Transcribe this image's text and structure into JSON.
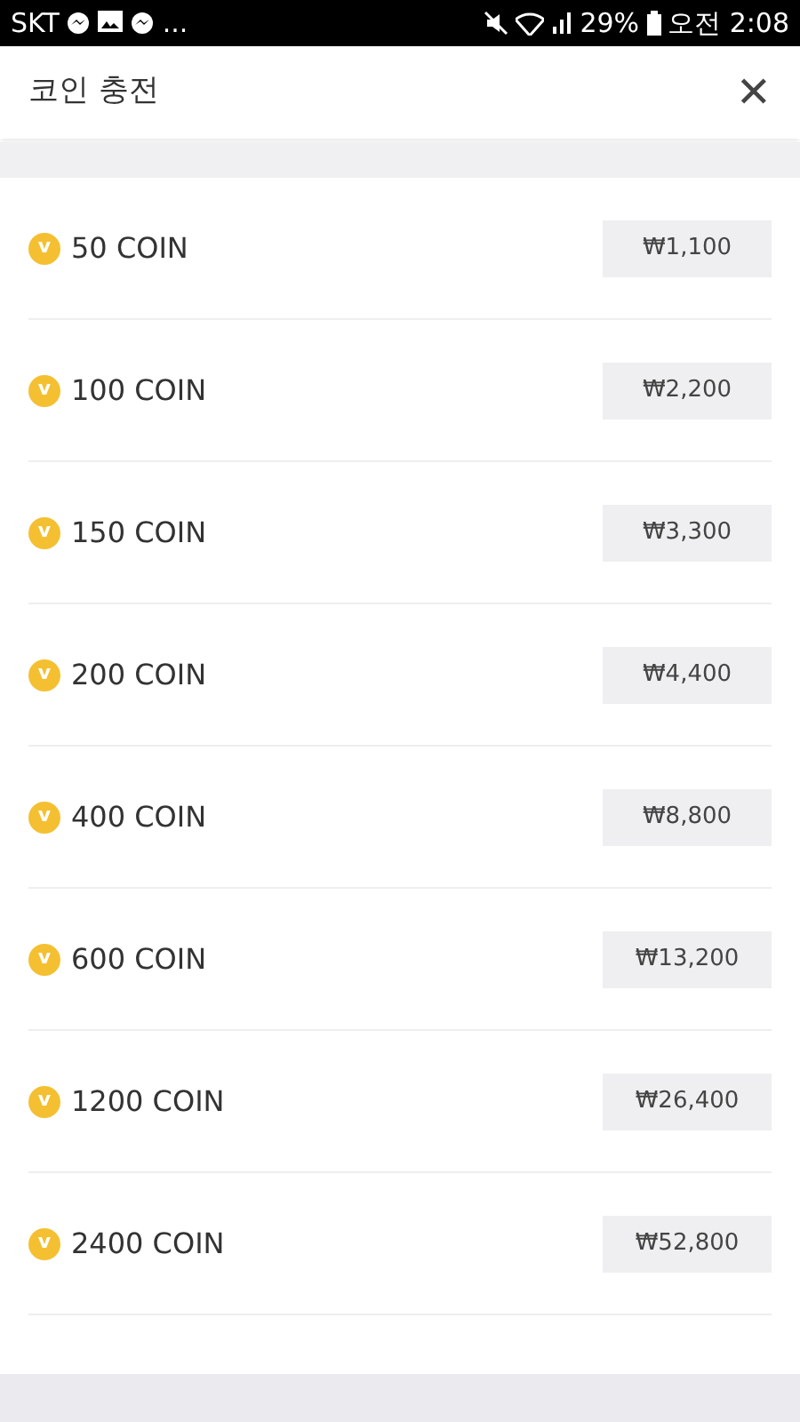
{
  "status_bar": {
    "carrier": "SKT",
    "more": "...",
    "battery": "29%",
    "time": "오전 2:08"
  },
  "header": {
    "title": "코인 충전",
    "close": "✕"
  },
  "packages": [
    {
      "coin_mark": "v",
      "label": "50 COIN",
      "price": "₩1,100"
    },
    {
      "coin_mark": "v",
      "label": "100 COIN",
      "price": "₩2,200"
    },
    {
      "coin_mark": "v",
      "label": "150 COIN",
      "price": "₩3,300"
    },
    {
      "coin_mark": "v",
      "label": "200 COIN",
      "price": "₩4,400"
    },
    {
      "coin_mark": "v",
      "label": "400 COIN",
      "price": "₩8,800"
    },
    {
      "coin_mark": "v",
      "label": "600 COIN",
      "price": "₩13,200"
    },
    {
      "coin_mark": "v",
      "label": "1200 COIN",
      "price": "₩26,400"
    },
    {
      "coin_mark": "v",
      "label": "2400 COIN",
      "price": "₩52,800"
    }
  ]
}
